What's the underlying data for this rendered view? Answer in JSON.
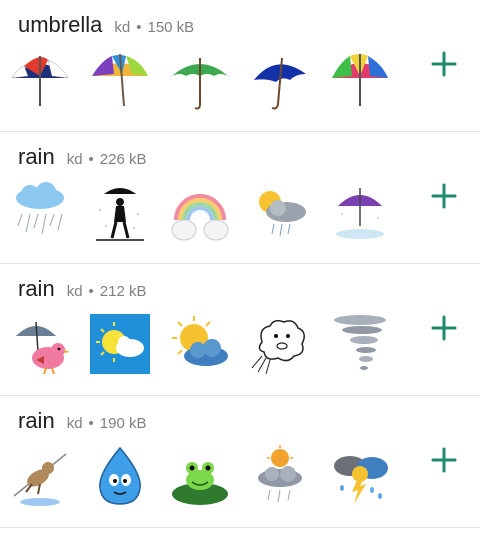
{
  "packs": [
    {
      "title": "umbrella",
      "author": "kd",
      "size": "150 kB",
      "stickers": [
        "umbrella-navy-red-icon",
        "umbrella-rainbow-icon",
        "umbrella-green-icon",
        "umbrella-blue-icon",
        "umbrella-multicolor-icon"
      ]
    },
    {
      "title": "rain",
      "author": "kd",
      "size": "226 kB",
      "stickers": [
        "rain-cloud-icon",
        "person-umbrella-rain-icon",
        "rainbow-clouds-icon",
        "sun-rain-cloud-icon",
        "purple-umbrella-icon"
      ]
    },
    {
      "title": "rain",
      "author": "kd",
      "size": "212 kB",
      "stickers": [
        "bird-umbrella-icon",
        "sun-cloud-tile-icon",
        "sun-behind-cloud-icon",
        "wind-face-cloud-icon",
        "tornado-icon"
      ]
    },
    {
      "title": "rain",
      "author": "kd",
      "size": "190 kB",
      "stickers": [
        "dog-in-rain-icon",
        "water-drop-face-icon",
        "frog-lily-pad-icon",
        "sun-storm-cloud-icon",
        "storm-clouds-icon"
      ]
    }
  ],
  "dot_separator": "•",
  "colors": {
    "accent": "#1e8a6e",
    "meta": "#808080",
    "divider": "#e2e2e2"
  }
}
